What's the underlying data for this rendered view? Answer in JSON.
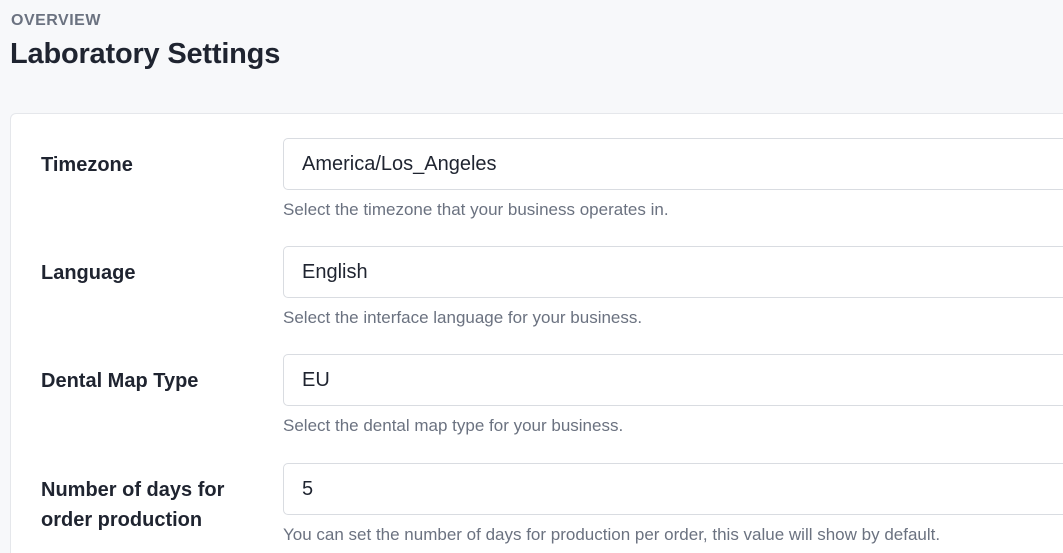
{
  "header": {
    "overline": "OVERVIEW",
    "title": "Laboratory Settings"
  },
  "fields": [
    {
      "label": "Timezone",
      "value": "America/Los_Angeles",
      "help": "Select the timezone that your business operates in."
    },
    {
      "label": "Language",
      "value": "English",
      "help": "Select the interface language for your business."
    },
    {
      "label": "Dental Map Type",
      "value": "EU",
      "help": "Select the dental map type for your business."
    },
    {
      "label_line1": "Number of days for",
      "label_line2": "order production",
      "value": "5",
      "help": "You can set the number of days for production per order, this value will show by default."
    }
  ]
}
